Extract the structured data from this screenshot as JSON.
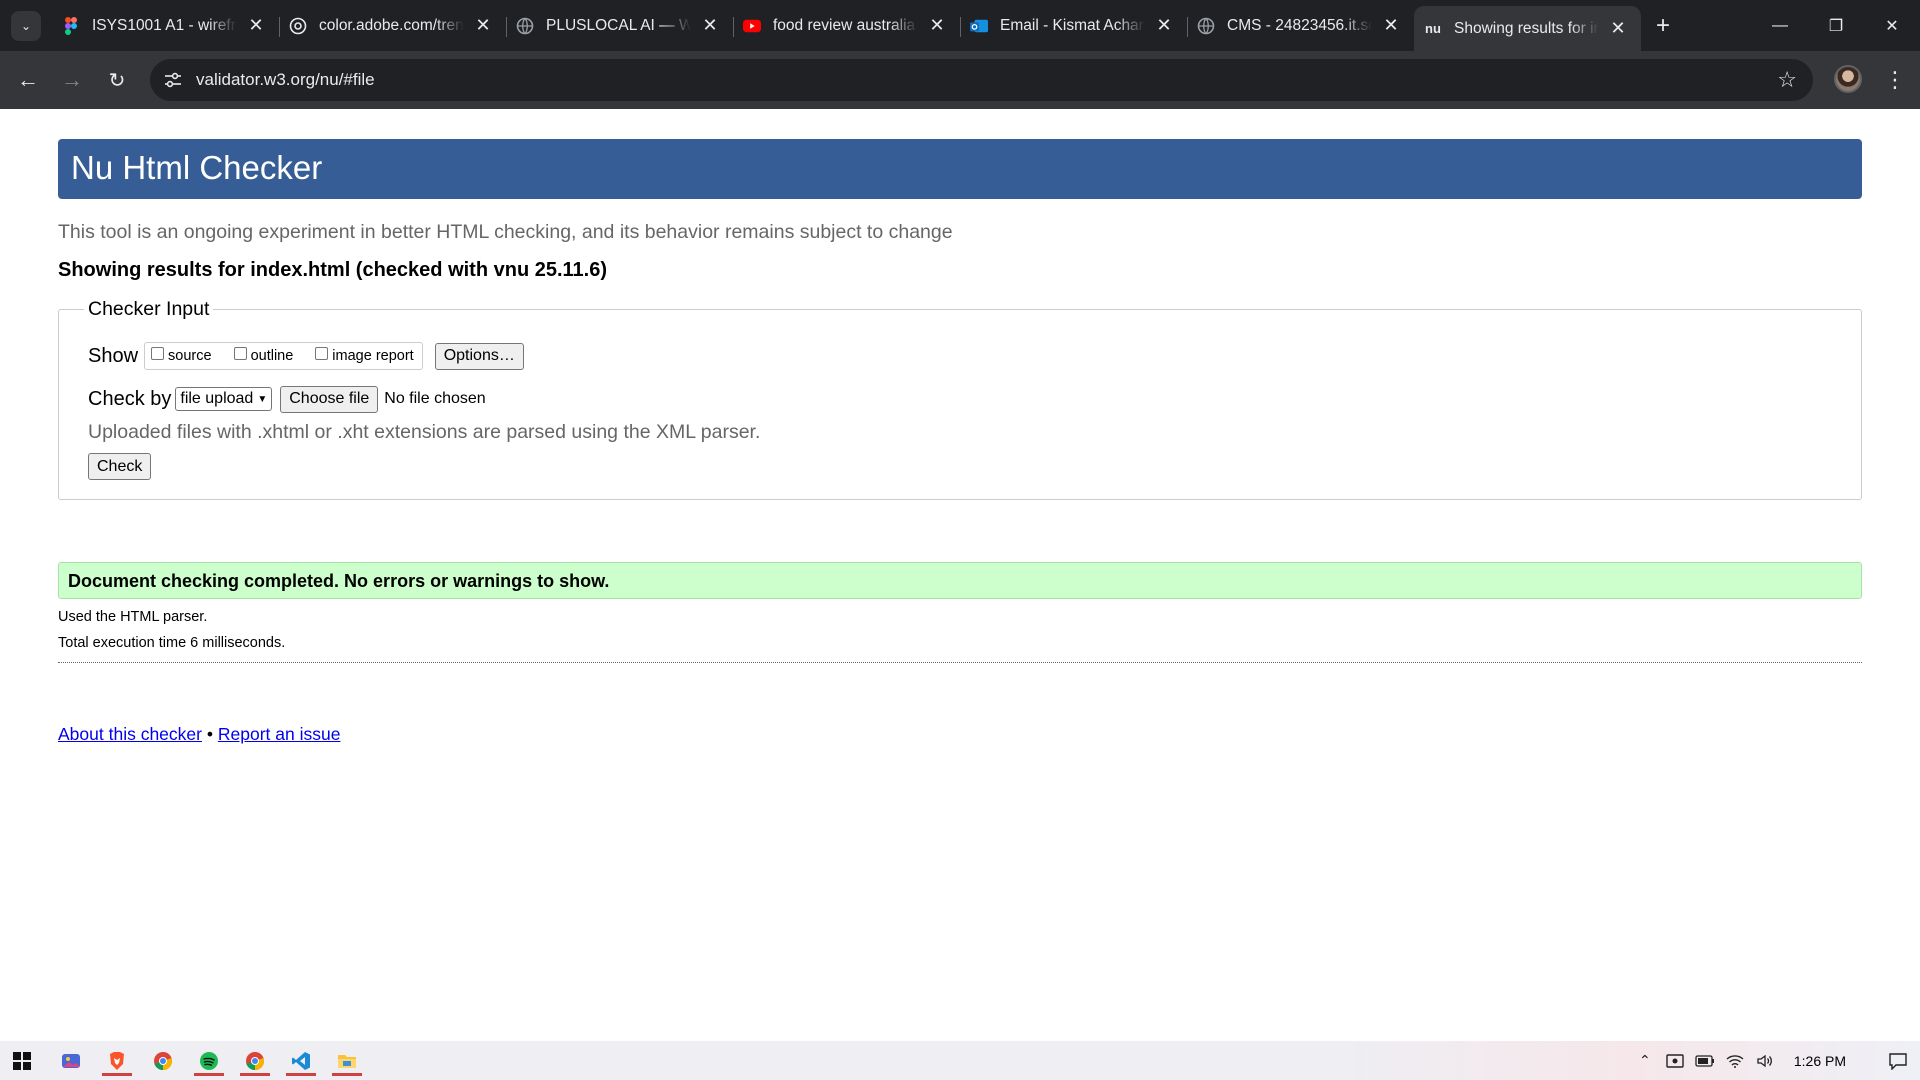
{
  "browser": {
    "tabs": [
      {
        "title": "ISYS1001 A1 - wirefra",
        "favicon": "figma-icon",
        "active": false
      },
      {
        "title": "color.adobe.com/tren",
        "favicon": "adobe-color-icon",
        "active": false
      },
      {
        "title": "PLUSLOCAL AI — We",
        "favicon": "globe-icon",
        "active": false
      },
      {
        "title": "food review australia",
        "favicon": "youtube-icon",
        "active": false
      },
      {
        "title": "Email - Kismat Achar",
        "favicon": "outlook-icon",
        "active": false
      },
      {
        "title": "CMS - 24823456.it.sc",
        "favicon": "globe-icon",
        "active": false
      },
      {
        "title": "Showing results for in",
        "favicon": "nu-icon",
        "active": true
      }
    ],
    "nu_favicon_text": "nu",
    "url": "validator.w3.org/nu/#file"
  },
  "page": {
    "header_title": "Nu Html Checker",
    "intro": "This tool is an ongoing experiment in better HTML checking, and its behavior remains subject to change",
    "results_heading": "Showing results for index.html (checked with vnu 25.11.6)",
    "checker": {
      "legend": "Checker Input",
      "show_label": "Show",
      "show_options": [
        "source",
        "outline",
        "image report"
      ],
      "options_button": "Options…",
      "check_by_label": "Check by",
      "check_by_value": "file upload",
      "choose_file_button": "Choose file",
      "no_file_text": "No file chosen",
      "parse_note": "Uploaded files with .xhtml or .xht extensions are parsed using the XML parser.",
      "check_button": "Check"
    },
    "success_message": "Document checking completed. No errors or warnings to show.",
    "parser_note": "Used the HTML parser.",
    "execution_time": "Total execution time 6 milliseconds.",
    "footer": {
      "about_link": "About this checker",
      "separator": "•",
      "report_link": "Report an issue"
    }
  },
  "taskbar": {
    "apps": [
      "windows-start-icon",
      "photos-icon",
      "brave-icon",
      "chrome-icon",
      "spotify-icon",
      "chrome-icon",
      "vscode-icon",
      "file-explorer-icon"
    ],
    "clock": "1:26 PM"
  },
  "colors": {
    "header": "#365d95",
    "success": "#ccffcc",
    "link": "#0000ee"
  }
}
